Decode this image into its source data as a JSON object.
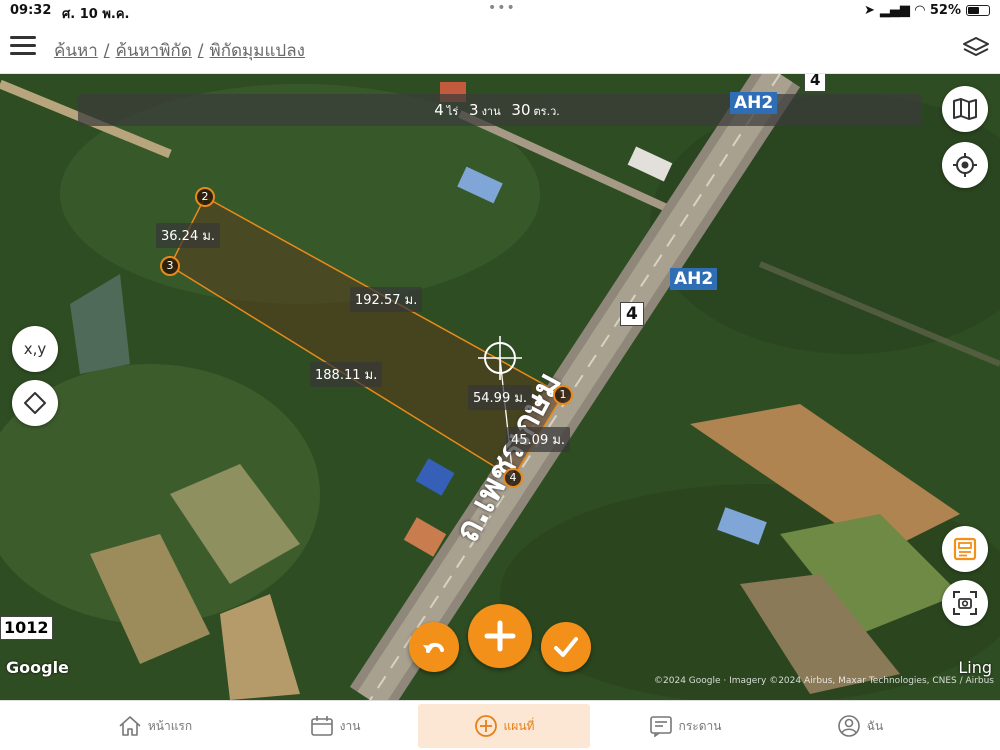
{
  "status_bar": {
    "time": "09:32",
    "date": "ศ. 10 พ.ค.",
    "dots": "•••",
    "battery": "52%"
  },
  "header": {
    "breadcrumb": [
      "ค้นหา",
      "/",
      "ค้นหาพิกัด",
      "/",
      "พิกัดมุมแปลง"
    ]
  },
  "map": {
    "area": {
      "rai": "4",
      "rai_unit": "ไร่",
      "ngan": "3",
      "ngan_unit": "งาน",
      "wa": "30",
      "wa_unit": "ตร.ว."
    },
    "segments": {
      "seg_2_3": "36.24 ม.",
      "seg_2_1": "192.57 ม.",
      "seg_3_4": "188.11 ม.",
      "seg_diag": "54.99 ม.",
      "seg_1_4": "45.09 ม."
    },
    "vertices": [
      "1",
      "2",
      "3",
      "4"
    ],
    "road_tags": {
      "route_4_top": "4",
      "route_4": "4",
      "ah2_top": "AH2",
      "ah2": "AH2",
      "route_1012": "1012"
    },
    "road_name": "ถ.เพชรเกษม",
    "attribution": {
      "google": "Google",
      "ling": "Ling",
      "copyright": "©2024 Google · Imagery ©2024 Airbus, Maxar Technologies, CNES / Airbus"
    },
    "xy_label": "x,y"
  },
  "colors": {
    "accent": "#f39019",
    "polygon": "#e88a1a",
    "ah_blue": "#2f6db5"
  },
  "bottom_nav": [
    {
      "label": "หน้าแรก",
      "icon": "home-icon",
      "active": false
    },
    {
      "label": "งาน",
      "icon": "calendar-icon",
      "active": false
    },
    {
      "label": "แผนที่",
      "icon": "plus-circle-icon",
      "active": true
    },
    {
      "label": "กระดาน",
      "icon": "board-icon",
      "active": false
    },
    {
      "label": "ฉัน",
      "icon": "user-icon",
      "active": false
    }
  ]
}
